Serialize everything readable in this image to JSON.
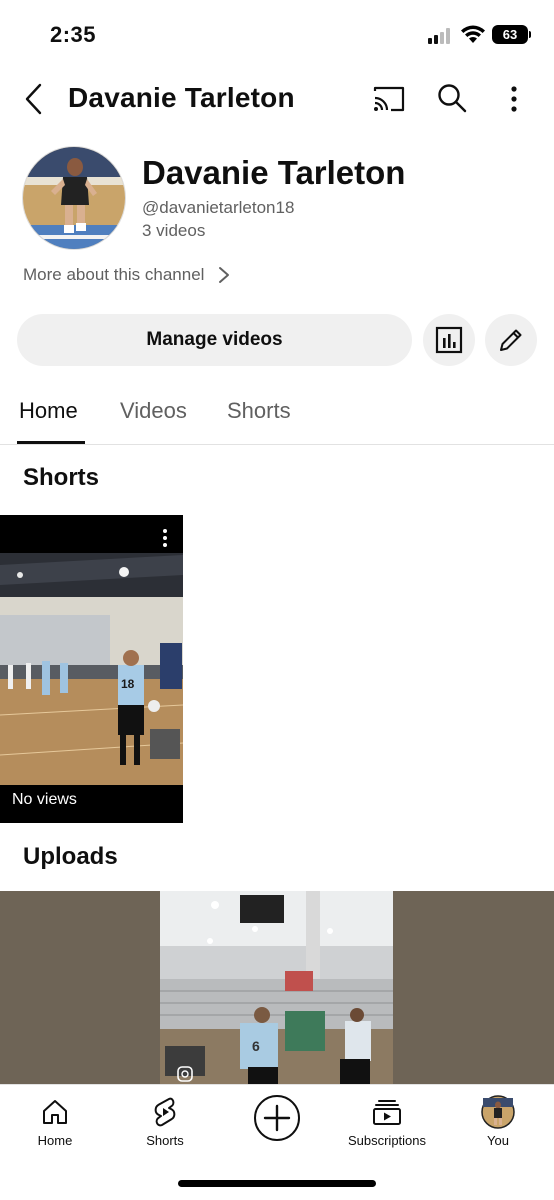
{
  "status_bar": {
    "time": "2:35",
    "battery": "63"
  },
  "top_bar": {
    "title": "Davanie Tarleton",
    "icons": [
      "back-icon",
      "cast-icon",
      "search-icon",
      "more-vertical-icon"
    ]
  },
  "channel": {
    "name": "Davanie Tarleton",
    "handle": "@davanietarleton18",
    "video_count": "3 videos",
    "more_about": "More about this channel"
  },
  "actions": {
    "manage_label": "Manage videos",
    "icons": [
      "analytics-icon",
      "edit-pencil-icon"
    ]
  },
  "tabs": [
    {
      "label": "Home",
      "active": true
    },
    {
      "label": "Videos",
      "active": false
    },
    {
      "label": "Shorts",
      "active": false
    }
  ],
  "sections": {
    "shorts_title": "Shorts",
    "uploads_title": "Uploads"
  },
  "shorts": [
    {
      "views": "No views",
      "jersey": "18"
    }
  ],
  "bottom_nav": [
    {
      "label": "Home",
      "icon": "home-icon"
    },
    {
      "label": "Shorts",
      "icon": "shorts-icon"
    },
    {
      "label": "",
      "icon": "create-plus-icon"
    },
    {
      "label": "Subscriptions",
      "icon": "subscriptions-icon"
    },
    {
      "label": "You",
      "icon": "avatar"
    }
  ]
}
